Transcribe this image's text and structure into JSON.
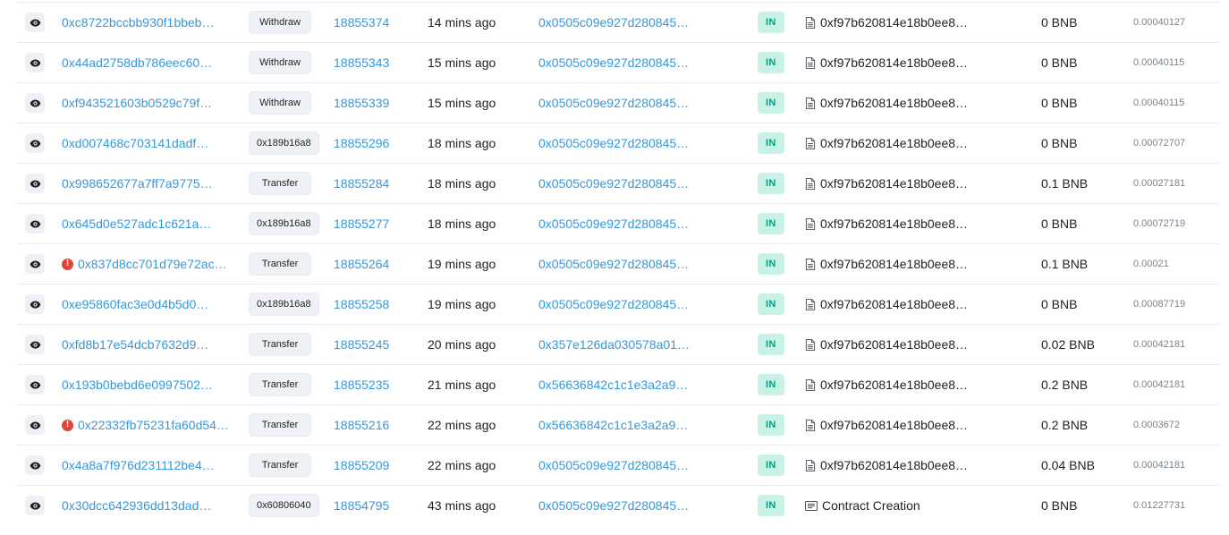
{
  "transactions": [
    {
      "hash": "0xc8722bccbb930f1bbeb…",
      "error": false,
      "method": "Withdraw",
      "method_hex": false,
      "block": "18855374",
      "age": "14 mins ago",
      "from": "0x0505c09e927d280845…",
      "direction": "IN",
      "to": "0xf97b620814e18b0ee8…",
      "to_kind": "document-icon",
      "value": "0 BNB",
      "fee": "0.00040127"
    },
    {
      "hash": "0x44ad2758db786eec60…",
      "error": false,
      "method": "Withdraw",
      "method_hex": false,
      "block": "18855343",
      "age": "15 mins ago",
      "from": "0x0505c09e927d280845…",
      "direction": "IN",
      "to": "0xf97b620814e18b0ee8…",
      "to_kind": "document-icon",
      "value": "0 BNB",
      "fee": "0.00040115"
    },
    {
      "hash": "0xf943521603b0529c79f…",
      "error": false,
      "method": "Withdraw",
      "method_hex": false,
      "block": "18855339",
      "age": "15 mins ago",
      "from": "0x0505c09e927d280845…",
      "direction": "IN",
      "to": "0xf97b620814e18b0ee8…",
      "to_kind": "document-icon",
      "value": "0 BNB",
      "fee": "0.00040115"
    },
    {
      "hash": "0xd007468c703141dadf…",
      "error": false,
      "method": "0x189b16a8",
      "method_hex": true,
      "block": "18855296",
      "age": "18 mins ago",
      "from": "0x0505c09e927d280845…",
      "direction": "IN",
      "to": "0xf97b620814e18b0ee8…",
      "to_kind": "document-icon",
      "value": "0 BNB",
      "fee": "0.00072707"
    },
    {
      "hash": "0x998652677a7ff7a9775…",
      "error": false,
      "method": "Transfer",
      "method_hex": false,
      "block": "18855284",
      "age": "18 mins ago",
      "from": "0x0505c09e927d280845…",
      "direction": "IN",
      "to": "0xf97b620814e18b0ee8…",
      "to_kind": "document-icon",
      "value": "0.1 BNB",
      "fee": "0.00027181"
    },
    {
      "hash": "0x645d0e527adc1c621a…",
      "error": false,
      "method": "0x189b16a8",
      "method_hex": true,
      "block": "18855277",
      "age": "18 mins ago",
      "from": "0x0505c09e927d280845…",
      "direction": "IN",
      "to": "0xf97b620814e18b0ee8…",
      "to_kind": "document-icon",
      "value": "0 BNB",
      "fee": "0.00072719"
    },
    {
      "hash": "0x837d8cc701d79e72ac…",
      "error": true,
      "method": "Transfer",
      "method_hex": false,
      "block": "18855264",
      "age": "19 mins ago",
      "from": "0x0505c09e927d280845…",
      "direction": "IN",
      "to": "0xf97b620814e18b0ee8…",
      "to_kind": "document-icon",
      "value": "0.1 BNB",
      "fee": "0.00021"
    },
    {
      "hash": "0xe95860fac3e0d4b5d0…",
      "error": false,
      "method": "0x189b16a8",
      "method_hex": true,
      "block": "18855258",
      "age": "19 mins ago",
      "from": "0x0505c09e927d280845…",
      "direction": "IN",
      "to": "0xf97b620814e18b0ee8…",
      "to_kind": "document-icon",
      "value": "0 BNB",
      "fee": "0.00087719"
    },
    {
      "hash": "0xfd8b17e54dcb7632d9…",
      "error": false,
      "method": "Transfer",
      "method_hex": false,
      "block": "18855245",
      "age": "20 mins ago",
      "from": "0x357e126da030578a01…",
      "direction": "IN",
      "to": "0xf97b620814e18b0ee8…",
      "to_kind": "document-icon",
      "value": "0.02 BNB",
      "fee": "0.00042181"
    },
    {
      "hash": "0x193b0bebd6e0997502…",
      "error": false,
      "method": "Transfer",
      "method_hex": false,
      "block": "18855235",
      "age": "21 mins ago",
      "from": "0x56636842c1c1e3a2a9…",
      "direction": "IN",
      "to": "0xf97b620814e18b0ee8…",
      "to_kind": "document-icon",
      "value": "0.2 BNB",
      "fee": "0.00042181"
    },
    {
      "hash": "0x22332fb75231fa60d54…",
      "error": true,
      "method": "Transfer",
      "method_hex": false,
      "block": "18855216",
      "age": "22 mins ago",
      "from": "0x56636842c1c1e3a2a9…",
      "direction": "IN",
      "to": "0xf97b620814e18b0ee8…",
      "to_kind": "document-icon",
      "value": "0.2 BNB",
      "fee": "0.0003672"
    },
    {
      "hash": "0x4a8a7f976d231112be4…",
      "error": false,
      "method": "Transfer",
      "method_hex": false,
      "block": "18855209",
      "age": "22 mins ago",
      "from": "0x0505c09e927d280845…",
      "direction": "IN",
      "to": "0xf97b620814e18b0ee8…",
      "to_kind": "document-icon",
      "value": "0.04 BNB",
      "fee": "0.00042181"
    },
    {
      "hash": "0x30dcc642936dd13dad…",
      "error": false,
      "method": "0x60806040",
      "method_hex": true,
      "block": "18854795",
      "age": "43 mins ago",
      "from": "0x0505c09e927d280845…",
      "direction": "IN",
      "to": "Contract Creation",
      "to_kind": "contract-creation-icon",
      "value": "0 BNB",
      "fee": "0.01227731"
    }
  ],
  "icons": {
    "eye": "eye-icon",
    "error": "exclamation-circle-icon"
  },
  "error_glyph": "!",
  "colors": {
    "link": "#3498db",
    "in_badge_bg": "#c8f2e6",
    "in_badge_text": "#00a186",
    "error": "#de4437"
  }
}
